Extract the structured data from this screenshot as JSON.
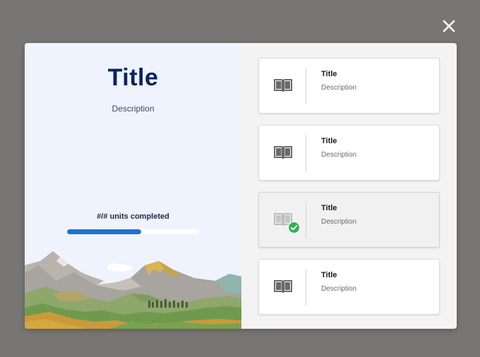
{
  "dialog": {
    "close_label": "✕"
  },
  "summary": {
    "title": "Title",
    "description": "Description",
    "progress_label": "#/# units completed",
    "progress_fraction": 0.56
  },
  "units": [
    {
      "title": "Title",
      "description": "Description",
      "icon": "book-icon",
      "completed": false
    },
    {
      "title": "Title",
      "description": "Description",
      "icon": "book-icon",
      "completed": false
    },
    {
      "title": "Title",
      "description": "Description",
      "icon": "book-icon",
      "completed": true
    },
    {
      "title": "Title",
      "description": "Description",
      "icon": "book-icon",
      "completed": false
    }
  ],
  "colors": {
    "accent": "#1b74d1",
    "title": "#0c2461",
    "check": "#2fb350"
  }
}
